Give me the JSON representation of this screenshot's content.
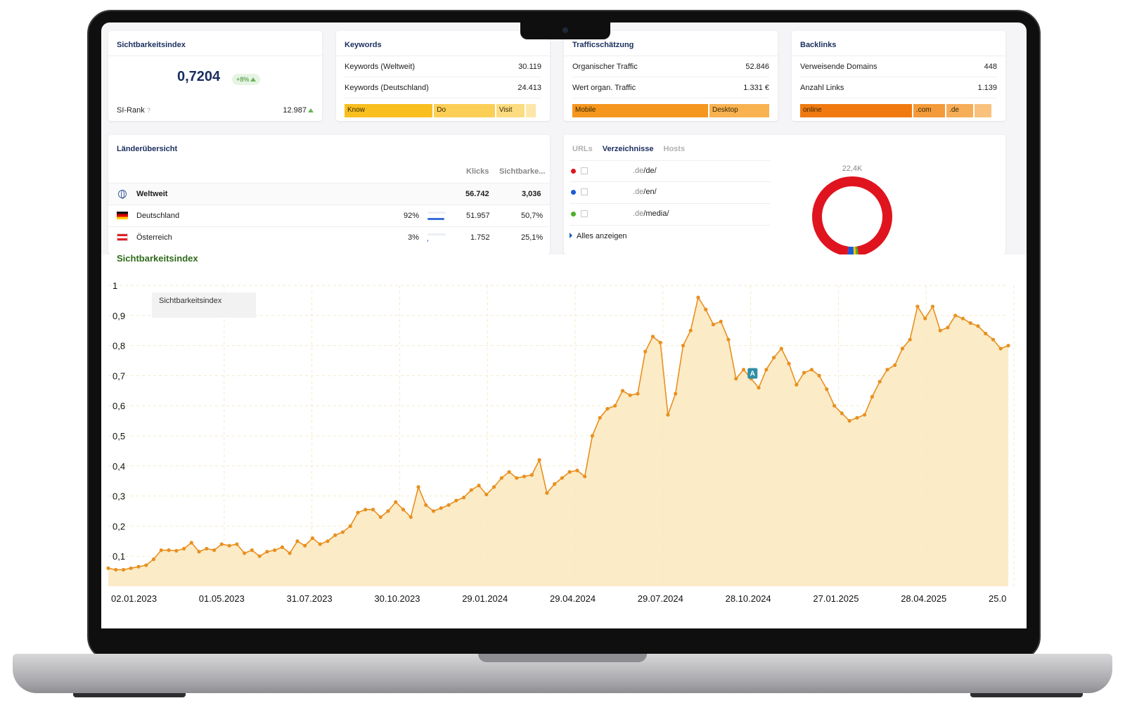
{
  "colors": {
    "accent_orange": "#e8901f",
    "area_fill": "#fae7bd",
    "navy": "#1a2e5e",
    "green_heading": "#2f6a1a",
    "donut_red": "#e0141e"
  },
  "si_card": {
    "title": "Sichtbarkeitsindex",
    "value": "0,7204",
    "change": "+8%",
    "rank_label": "SI-Rank",
    "rank_help": "?",
    "rank_value": "12.987"
  },
  "keywords_card": {
    "title": "Keywords",
    "rows": [
      {
        "label": "Keywords (Weltweit)",
        "value": "30.119"
      },
      {
        "label": "Keywords (Deutschland)",
        "value": "24.413"
      }
    ],
    "segments": [
      {
        "label": "Know",
        "share": 0.47
      },
      {
        "label": "Do",
        "share": 0.32
      },
      {
        "label": "Visit",
        "share": 0.14
      },
      {
        "label": "",
        "share": 0.04
      }
    ]
  },
  "traffic_card": {
    "title": "Trafficschätzung",
    "rows": [
      {
        "label": "Organischer Traffic",
        "value": "52.846"
      },
      {
        "label": "Wert organ. Traffic",
        "value": "1.331 €"
      }
    ],
    "segments": [
      {
        "label": "Mobile",
        "share": 0.7
      },
      {
        "label": "Desktop",
        "share": 0.3
      }
    ]
  },
  "backlinks_card": {
    "title": "Backlinks",
    "rows": [
      {
        "label": "Verweisende Domains",
        "value": "448"
      },
      {
        "label": "Anzahl Links",
        "value": "1.139"
      }
    ],
    "segments": [
      {
        "label": "online",
        "share": 0.6
      },
      {
        "label": ".com",
        "share": 0.16
      },
      {
        "label": ".de",
        "share": 0.13
      },
      {
        "label": "",
        "share": 0.08
      }
    ]
  },
  "countries_card": {
    "title": "Länderübersicht",
    "col_clicks": "Klicks",
    "col_si": "Sichtbarke...",
    "rows": [
      {
        "name": "Weltweit",
        "share": "",
        "share_value": 0,
        "clicks": "56.742",
        "si": "3,036"
      },
      {
        "name": "Deutschland",
        "share": "92%",
        "share_value": 0.92,
        "clicks": "51.957",
        "si": "50,7%"
      },
      {
        "name": "Österreich",
        "share": "3%",
        "share_value": 0.03,
        "clicks": "1.752",
        "si": "25,1%"
      }
    ]
  },
  "dirs_card": {
    "tabs": [
      "URLs",
      "Verzeichnisse",
      "Hosts"
    ],
    "active_tab": "Verzeichnisse",
    "rows": [
      {
        "prefix": ".de",
        "path": "/de/",
        "color": "#e0141e"
      },
      {
        "prefix": ".de",
        "path": "/en/",
        "color": "#1a5bd8"
      },
      {
        "prefix": ".de",
        "path": "/media/",
        "color": "#4caf2a"
      }
    ],
    "show_all": "Alles anzeigen",
    "donut_total": "22,4K",
    "donut_shares": [
      {
        "color": "#e0141e",
        "value": 0.955
      },
      {
        "color": "#4caf2a",
        "value": 0.01
      },
      {
        "color": "#f2c200",
        "value": 0.01
      },
      {
        "color": "#1a5bd8",
        "value": 0.025
      }
    ]
  },
  "chart_heading": "Sichtbarkeitsindex",
  "chart_data": {
    "type": "area",
    "title": "Sichtbarkeitsindex",
    "legend": "Sichtbarkeitsindex",
    "ylim": [
      0,
      1
    ],
    "yticks": [
      "0,1",
      "0,2",
      "0,3",
      "0,4",
      "0,5",
      "0,6",
      "0,7",
      "0,8",
      "0,9",
      "1"
    ],
    "xticks": [
      "02.01.2023",
      "01.05.2023",
      "31.07.2023",
      "30.10.2023",
      "29.01.2024",
      "29.04.2024",
      "29.07.2024",
      "28.10.2024",
      "27.01.2025",
      "28.04.2025",
      "25.0"
    ],
    "grid": true,
    "annotation": {
      "label": "A",
      "index": 85
    },
    "series": [
      {
        "name": "Sichtbarkeitsindex",
        "values": [
          0.06,
          0.055,
          0.055,
          0.06,
          0.065,
          0.07,
          0.09,
          0.12,
          0.12,
          0.118,
          0.125,
          0.145,
          0.115,
          0.125,
          0.12,
          0.14,
          0.135,
          0.14,
          0.11,
          0.12,
          0.1,
          0.115,
          0.12,
          0.13,
          0.11,
          0.15,
          0.135,
          0.16,
          0.14,
          0.15,
          0.17,
          0.18,
          0.2,
          0.245,
          0.255,
          0.255,
          0.23,
          0.25,
          0.28,
          0.255,
          0.23,
          0.33,
          0.27,
          0.25,
          0.26,
          0.27,
          0.285,
          0.295,
          0.32,
          0.335,
          0.305,
          0.33,
          0.36,
          0.38,
          0.36,
          0.365,
          0.37,
          0.42,
          0.31,
          0.34,
          0.36,
          0.38,
          0.385,
          0.365,
          0.5,
          0.56,
          0.59,
          0.6,
          0.65,
          0.635,
          0.64,
          0.78,
          0.83,
          0.81,
          0.57,
          0.64,
          0.8,
          0.85,
          0.96,
          0.92,
          0.87,
          0.88,
          0.82,
          0.69,
          0.72,
          0.69,
          0.66,
          0.72,
          0.76,
          0.79,
          0.74,
          0.67,
          0.71,
          0.72,
          0.7,
          0.655,
          0.6,
          0.575,
          0.55,
          0.56,
          0.57,
          0.63,
          0.68,
          0.72,
          0.735,
          0.79,
          0.82,
          0.93,
          0.89,
          0.93,
          0.85,
          0.86,
          0.9,
          0.89,
          0.875,
          0.865,
          0.84,
          0.82,
          0.79,
          0.8
        ]
      }
    ]
  }
}
